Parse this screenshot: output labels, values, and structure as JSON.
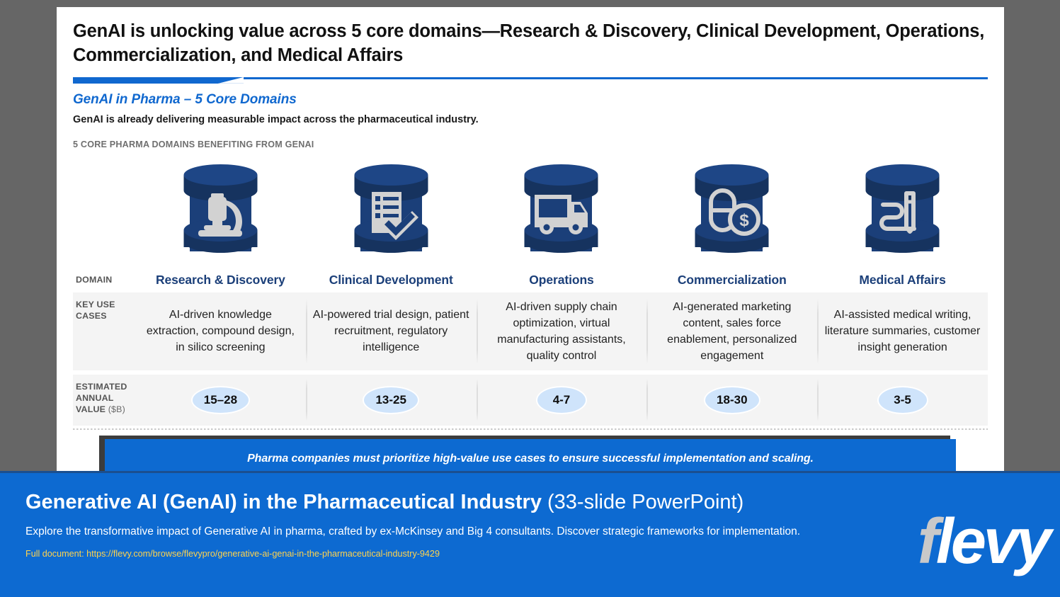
{
  "slide": {
    "title": "GenAI is unlocking value across 5 core domains—Research & Discovery, Clinical Development, Operations, Commercialization, and Medical Affairs",
    "section_title": "GenAI in Pharma – 5 Core Domains",
    "section_subtitle": "GenAI is already delivering measurable impact across the pharmaceutical industry.",
    "eyebrow": "5 CORE PHARMA DOMAINS BENEFITING FROM GENAI",
    "row_labels": {
      "domain": "DOMAIN",
      "key_use_cases": "KEY USE CASES",
      "estimated_annual_value": "ESTIMATED ANNUAL VALUE",
      "estimated_annual_value_unit": " ($B)"
    },
    "columns": [
      {
        "icon": "microscope-icon",
        "domain": "Research & Discovery",
        "use_cases": "AI-driven knowledge extraction, compound design, in silico screening",
        "value": "15–28"
      },
      {
        "icon": "clipboard-check-icon",
        "domain": "Clinical Development",
        "use_cases": "AI-powered trial design, patient recruitment, regulatory intelligence",
        "value": "13-25"
      },
      {
        "icon": "delivery-truck-icon",
        "domain": "Operations",
        "use_cases": "AI-driven supply chain optimization, virtual manufacturing assistants, quality control",
        "value": "4-7"
      },
      {
        "icon": "pill-dollar-icon",
        "domain": "Commercialization",
        "use_cases": "AI-generated marketing content, sales force enablement, personalized engagement",
        "value": "18-30"
      },
      {
        "icon": "pen-writing-icon",
        "domain": "Medical Affairs",
        "use_cases": "AI-assisted medical writing, literature summaries, customer insight generation",
        "value": "3-5"
      }
    ],
    "callout": "Pharma companies must prioritize high-value use cases to ensure successful implementation and scaling."
  },
  "banner": {
    "title_bold": "Generative AI (GenAI) in the Pharmaceutical Industry",
    "title_light": " (33-slide PowerPoint)",
    "description": "Explore the transformative impact of Generative AI in pharma, crafted by ex-McKinsey and Big 4 consultants. Discover strategic frameworks for implementation.",
    "url": "Full document: https://flevy.com/browse/flevypro/generative-ai-genai-in-the-pharmaceutical-industry-9429",
    "logo_f": "f",
    "logo_rest": "levy"
  },
  "colors": {
    "brand_blue": "#0d6ad1",
    "accent_blue": "#1068cf",
    "drum_navy": "#1b3f79",
    "drum_navy_dark": "#16335f",
    "domain_text": "#1b3f79",
    "pill_fill": "#cfe4fb",
    "band_gray": "#f4f4f4",
    "url_yellow": "#ffd34d",
    "page_gray": "#666666"
  }
}
